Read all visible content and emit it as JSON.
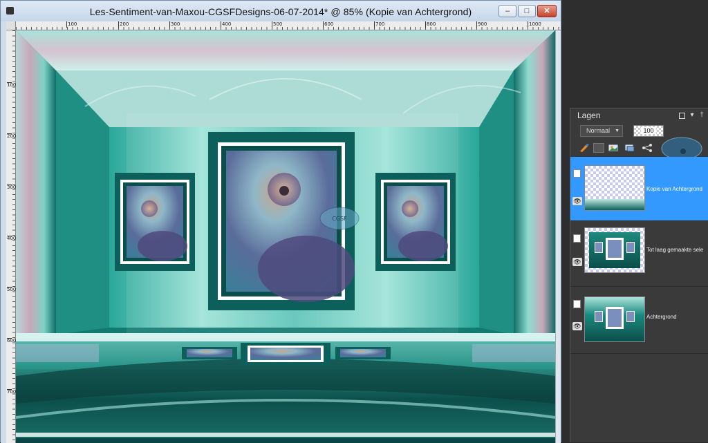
{
  "window": {
    "title": "Les-Sentiment-van-Maxou-CGSFDesigns-06-07-2014* @  85% (Kopie van Achtergrond)",
    "minimize_glyph": "–",
    "maximize_glyph": "□",
    "close_glyph": "✕"
  },
  "ruler": {
    "top_ticks": [
      "100",
      "200",
      "300",
      "400",
      "500",
      "600",
      "700",
      "800",
      "900",
      "1000"
    ],
    "left_ticks": [
      "100",
      "200",
      "300",
      "400",
      "500",
      "600",
      "700"
    ]
  },
  "canvas": {
    "watermark": "CGSF"
  },
  "layers_panel": {
    "title": "Lagen",
    "header_icons": [
      "restore-icon",
      "dropdown-icon",
      "pin-icon",
      "close-icon"
    ],
    "header_glyphs": {
      "dropdown": "▾",
      "pin": "†",
      "close": "✕"
    },
    "blend_mode": "Normaal",
    "opacity": "100",
    "layers": [
      {
        "name": "Kopie van Achtergrond",
        "selected": true,
        "thumbnail": "transparent-with-floor"
      },
      {
        "name": "Tot laag gemaakte sele",
        "selected": false,
        "thumbnail": "room-scene"
      },
      {
        "name": "Achtergrond",
        "selected": false,
        "thumbnail": "room-scene-full"
      }
    ]
  },
  "colors": {
    "selection": "#3399ff",
    "panel_bg": "#3a3a3a",
    "teal": "#137a72",
    "close_button": "#c8442c"
  }
}
